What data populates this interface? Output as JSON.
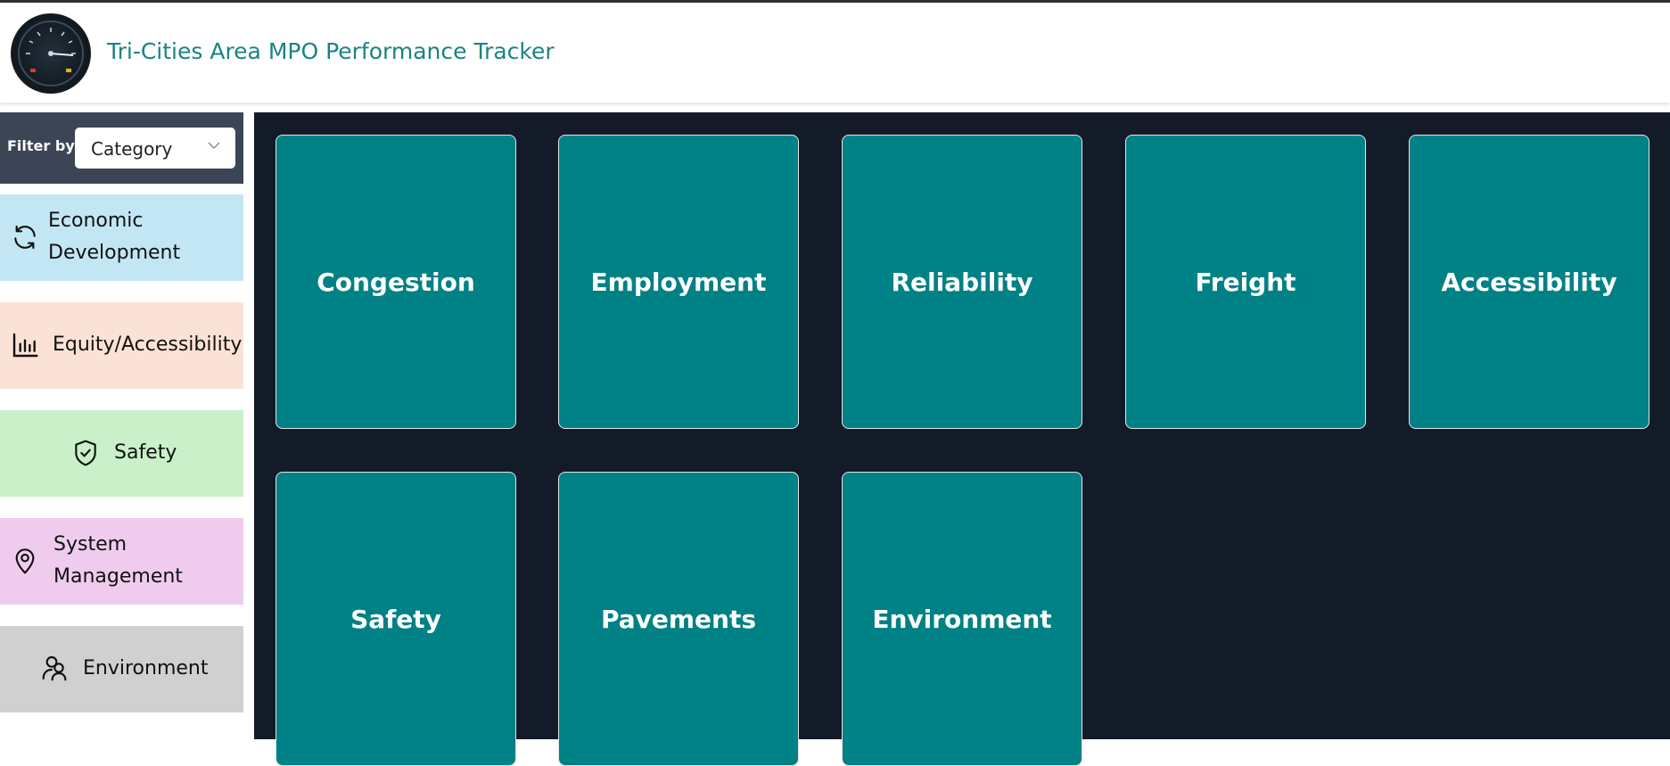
{
  "header": {
    "title": "Tri-Cities Area MPO Performance Tracker",
    "logo_icon": "speedometer-gauge-icon"
  },
  "filter": {
    "label": "Filter by:",
    "selected": "Category"
  },
  "sidebar": {
    "items": [
      {
        "label": "Economic Development",
        "line1": "Economic",
        "line2": "Development",
        "icon": "refresh-icon",
        "color": "#c3e6f5"
      },
      {
        "label": "Equity/Accessibility",
        "icon": "bar-chart-icon",
        "color": "#fbe2d6"
      },
      {
        "label": "Safety",
        "icon": "shield-check-icon",
        "color": "#c9f0c8"
      },
      {
        "label": "System Management",
        "line1": "System",
        "line2": "Management",
        "icon": "map-pin-icon",
        "color": "#efccee"
      },
      {
        "label": "Environment",
        "icon": "users-icon",
        "color": "#d0d0d0"
      }
    ]
  },
  "tiles": [
    {
      "label": "Congestion"
    },
    {
      "label": "Employment"
    },
    {
      "label": "Reliability"
    },
    {
      "label": "Freight"
    },
    {
      "label": "Accessibility"
    },
    {
      "label": "Safety"
    },
    {
      "label": "Pavements"
    },
    {
      "label": "Environment"
    }
  ],
  "colors": {
    "accent": "#1b8383",
    "tile": "#008185",
    "main_bg": "#131a28",
    "filter_bg": "#3b4555"
  }
}
